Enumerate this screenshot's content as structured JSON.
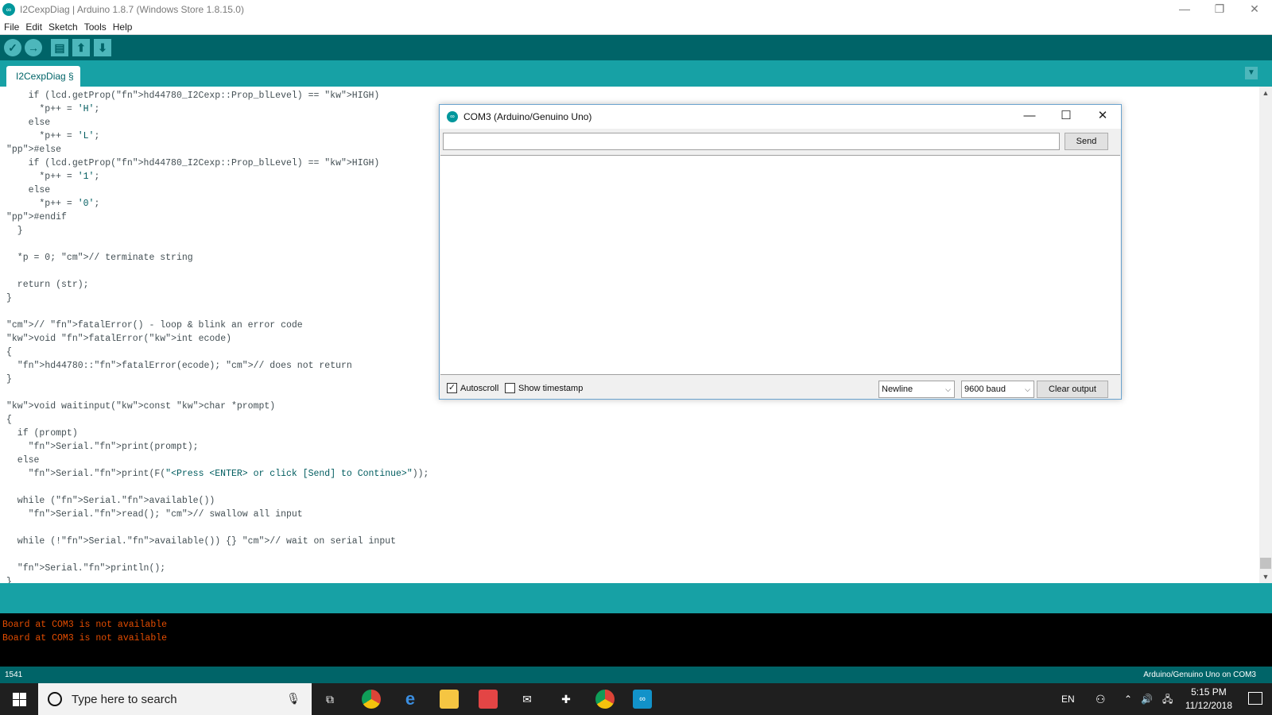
{
  "window": {
    "title": "I2CexpDiag | Arduino 1.8.7 (Windows Store 1.8.15.0)",
    "minimize": "—",
    "restore": "❐",
    "close": "✕"
  },
  "menu": [
    "File",
    "Edit",
    "Sketch",
    "Tools",
    "Help"
  ],
  "toolbar": {
    "buttons": [
      {
        "name": "verify",
        "icon": "check-icon",
        "glyph": "✓"
      },
      {
        "name": "upload",
        "icon": "arrow-right-icon",
        "glyph": "→"
      },
      {
        "name": "new",
        "icon": "new-file-icon",
        "glyph": "▤"
      },
      {
        "name": "open",
        "icon": "arrow-up-icon",
        "glyph": "⬆"
      },
      {
        "name": "save",
        "icon": "arrow-down-icon",
        "glyph": "⬇"
      }
    ],
    "serial_monitor_icon": "magnifier-icon"
  },
  "tabs": [
    {
      "label": "I2CexpDiag §"
    }
  ],
  "code_lines": [
    "    if (lcd.getProp(hd44780_I2Cexp::Prop_blLevel) == HIGH)",
    "      *p++ = 'H';",
    "    else",
    "      *p++ = 'L';",
    "#else",
    "    if (lcd.getProp(hd44780_I2Cexp::Prop_blLevel) == HIGH)",
    "      *p++ = '1';",
    "    else",
    "      *p++ = '0';",
    "#endif",
    "  }",
    "",
    "  *p = 0; // terminate string",
    "",
    "  return (str);",
    "}",
    "",
    "// fatalError() - loop & blink an error code",
    "void fatalError(int ecode)",
    "{",
    "  hd44780::fatalError(ecode); // does not return",
    "}",
    "",
    "void waitinput(const char *prompt)",
    "{",
    "  if (prompt)",
    "    Serial.print(prompt);",
    "  else",
    "    Serial.print(F(\"<Press <ENTER> or click [Send] to Continue>\"));",
    "",
    "  while (Serial.available())",
    "    Serial.read(); // swallow all input",
    "",
    "  while (!Serial.available()) {} // wait on serial input",
    "",
    "  Serial.println();",
    "}"
  ],
  "serial_monitor": {
    "title": "COM3 (Arduino/Genuino Uno)",
    "input_value": "",
    "send_label": "Send",
    "autoscroll_label": "Autoscroll",
    "autoscroll_checked": true,
    "timestamp_label": "Show timestamp",
    "timestamp_checked": false,
    "line_ending": "Newline",
    "baud": "9600 baud",
    "clear_label": "Clear output"
  },
  "console": [
    "Board at COM3 is not available",
    "Board at COM3 is not available"
  ],
  "footer": {
    "line_number": "1541",
    "board": "Arduino/Genuino Uno on COM3"
  },
  "taskbar": {
    "search_placeholder": "Type here to search",
    "language": "EN",
    "time": "5:15 PM",
    "date": "11/12/2018"
  },
  "colors": {
    "toolbar": "#006468",
    "tabbar": "#17a1a5",
    "console_text": "#e34c00"
  }
}
